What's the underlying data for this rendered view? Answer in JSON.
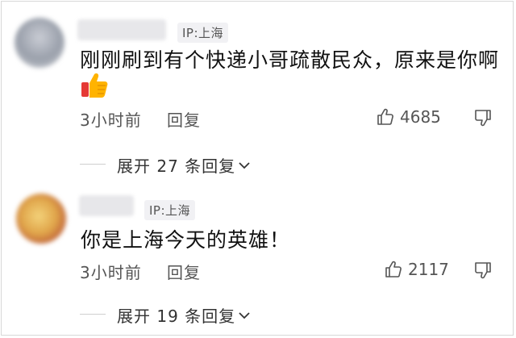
{
  "comments": [
    {
      "ip_label": "IP:上海",
      "text": "刚刚刷到有个快递小哥疏散民众，原来是你啊",
      "emoji_icon": "thumbs-up-emoji-icon",
      "time": "3小时前",
      "reply_label": "回复",
      "likes": "4685",
      "expand_label": "展开 27 条回复"
    },
    {
      "ip_label": "IP:上海",
      "text": "你是上海今天的英雄！",
      "time": "3小时前",
      "reply_label": "回复",
      "likes": "2117",
      "expand_label": "展开 19 条回复"
    }
  ],
  "colors": {
    "text": "#111111",
    "muted": "#555555",
    "ip_badge_bg": "#f1f1f4"
  }
}
